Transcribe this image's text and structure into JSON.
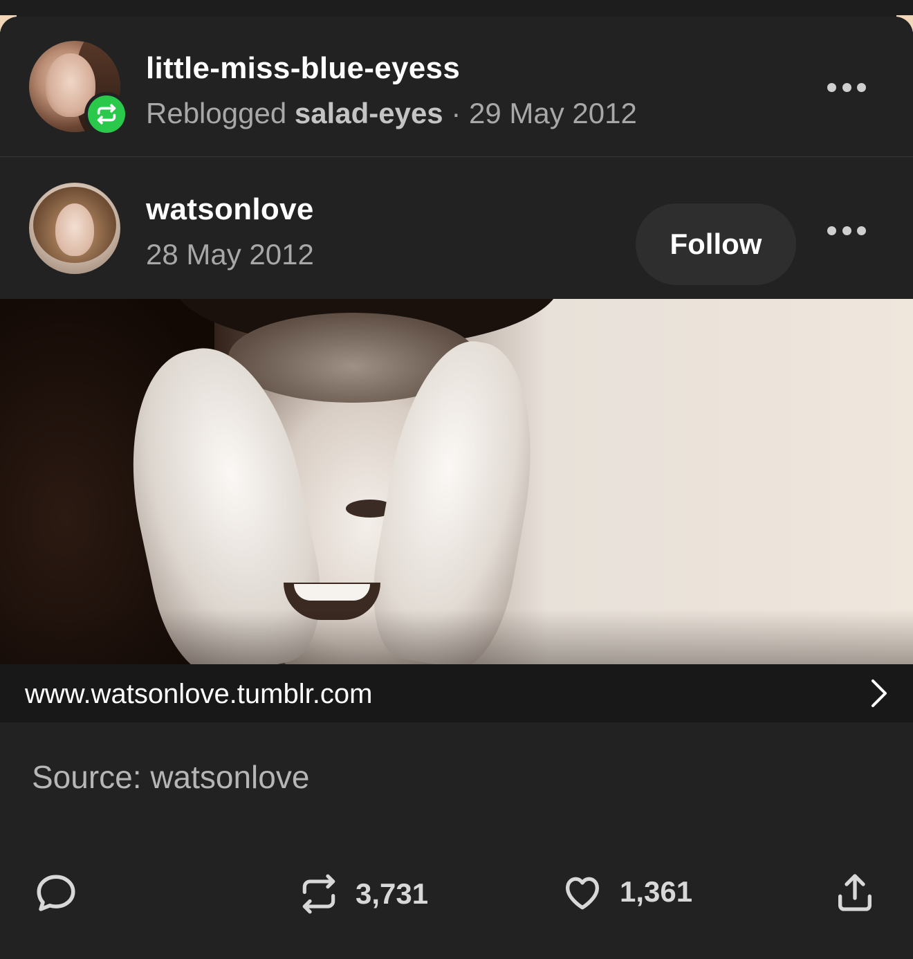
{
  "reblog": {
    "blog_name": "little-miss-blue-eyess",
    "action": "Reblogged",
    "from_blog": "salad-eyes",
    "separator": "·",
    "date": "29 May 2012"
  },
  "post": {
    "author": "watsonlove",
    "date": "28 May 2012",
    "follow_label": "Follow",
    "image_alt": "Animated image of a woman covering her face with her hands and smiling",
    "link_url": "www.watsonlove.tumblr.com",
    "source_label": "Source:",
    "source_blog": "watsonlove"
  },
  "footer": {
    "reblog_count": "3,731",
    "like_count": "1,361"
  },
  "icons": {
    "reblog_badge": "reblog-icon",
    "more": "more-options-icon",
    "reply": "comment-icon",
    "reblog": "reblog-icon",
    "like": "heart-icon",
    "share": "share-icon",
    "chevron": "chevron-right-icon"
  },
  "colors": {
    "background": "#222222",
    "reblog_badge": "#2ac94b",
    "follow_button": "#2e2e2e",
    "muted_text": "#a8a8a8"
  }
}
